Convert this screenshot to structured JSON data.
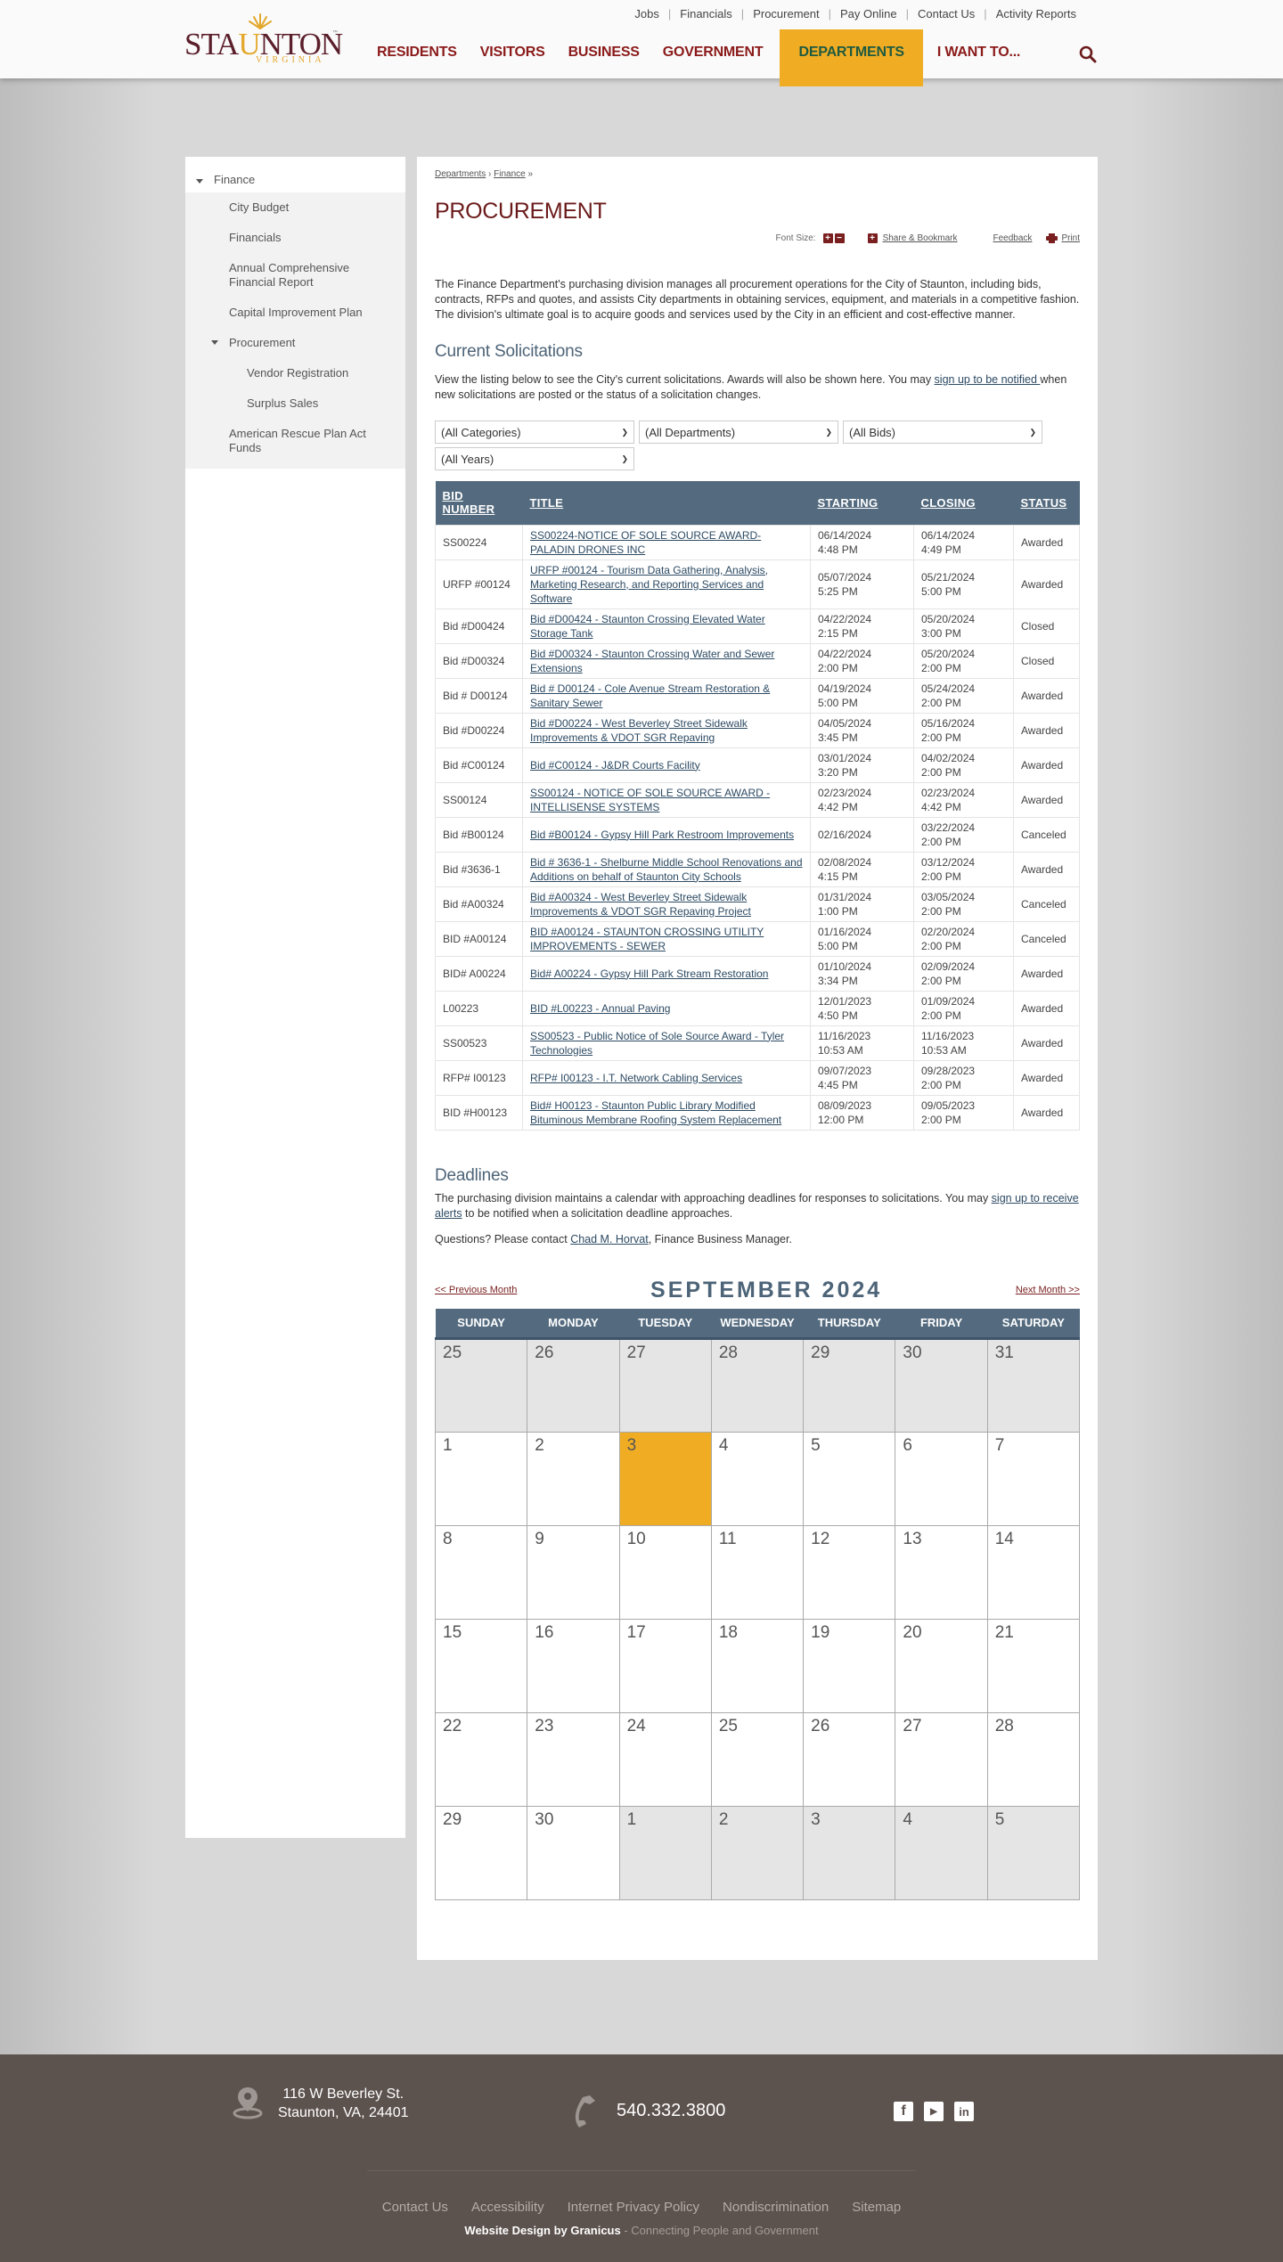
{
  "brand": {
    "name": "STAUNTON",
    "name_pre": "STA",
    "name_u": "U",
    "name_post": "NTON",
    "sub": "VIRGINIA",
    "tm": "™",
    "accent": "#f0ad24",
    "maroon": "#7a1f1f",
    "slate": "#546b7f"
  },
  "utility_nav": [
    "Jobs",
    "Financials",
    "Procurement",
    "Pay Online",
    "Contact Us",
    "Activity Reports"
  ],
  "main_nav": [
    {
      "label": "RESIDENTS",
      "active": false
    },
    {
      "label": "VISITORS",
      "active": false
    },
    {
      "label": "BUSINESS",
      "active": false
    },
    {
      "label": "GOVERNMENT",
      "active": false
    },
    {
      "label": "DEPARTMENTS",
      "active": true
    },
    {
      "label": "I WANT TO...",
      "active": false
    }
  ],
  "sidebar": {
    "top": "Finance",
    "items": [
      {
        "label": "City Budget"
      },
      {
        "label": "Financials"
      },
      {
        "label": "Annual Comprehensive Financial Report"
      },
      {
        "label": "Capital Improvement Plan"
      },
      {
        "label": "Procurement"
      },
      {
        "label": "Vendor Registration"
      },
      {
        "label": "Surplus Sales"
      },
      {
        "label": "American Rescue Plan Act Funds"
      }
    ]
  },
  "breadcrumb": [
    "Departments",
    "Finance"
  ],
  "breadcrumb_sep": "›",
  "breadcrumb_end": "»",
  "page_title": "PROCUREMENT",
  "tools": {
    "font_size": "Font Size:",
    "plus": "+",
    "minus": "−",
    "share": "Share & Bookmark",
    "feedback": "Feedback",
    "print": "Print"
  },
  "intro": "The Finance Department's purchasing division manages all procurement operations for the City of Staunton, including bids, contracts, RFPs and quotes, and assists City departments in obtaining services, equipment, and materials in a competitive fashion. The division's ultimate goal is to acquire goods and services used by the City in an efficient and cost-effective manner.",
  "solicitations": {
    "heading": "Current Solicitations",
    "text_before": "View the listing below to see the City's current solicitations. Awards will also be shown here. You may ",
    "link": "sign up to be notified ",
    "text_after": "when new solicitations are posted or the status of a solicitation changes.",
    "filters": [
      "(All Categories)",
      "(All Departments)",
      "(All Bids)",
      "(All Years)"
    ],
    "columns": [
      "BID NUMBER",
      "TITLE",
      "STARTING",
      "CLOSING",
      "STATUS"
    ],
    "rows": [
      {
        "bid": "SS00224",
        "title": "SS00224-NOTICE OF SOLE SOURCE AWARD-PALADIN DRONES INC",
        "start_date": "06/14/2024",
        "start_time": "4:48 PM",
        "close_date": "06/14/2024",
        "close_time": "4:49 PM",
        "status": "Awarded"
      },
      {
        "bid": "URFP #00124",
        "title": "URFP #00124 - Tourism Data Gathering, Analysis, Marketing Research, and Reporting Services and Software",
        "start_date": "05/07/2024",
        "start_time": "5:25 PM",
        "close_date": "05/21/2024",
        "close_time": "5:00 PM",
        "status": "Awarded"
      },
      {
        "bid": "Bid #D00424",
        "title": "Bid #D00424 - Staunton Crossing Elevated Water Storage Tank",
        "start_date": "04/22/2024",
        "start_time": "2:15 PM",
        "close_date": "05/20/2024",
        "close_time": "3:00 PM",
        "status": "Closed"
      },
      {
        "bid": "Bid #D00324",
        "title": "Bid #D00324 - Staunton Crossing Water and Sewer Extensions",
        "start_date": "04/22/2024",
        "start_time": "2:00 PM",
        "close_date": "05/20/2024",
        "close_time": "2:00 PM",
        "status": "Closed"
      },
      {
        "bid": "Bid # D00124",
        "title": "Bid # D00124 - Cole Avenue Stream Restoration & Sanitary Sewer",
        "start_date": "04/19/2024",
        "start_time": "5:00 PM",
        "close_date": "05/24/2024",
        "close_time": "2:00 PM",
        "status": "Awarded"
      },
      {
        "bid": "Bid #D00224",
        "title": "Bid #D00224 - West Beverley Street Sidewalk Improvements & VDOT SGR Repaving",
        "start_date": "04/05/2024",
        "start_time": "3:45 PM",
        "close_date": "05/16/2024",
        "close_time": "2:00 PM",
        "status": "Awarded"
      },
      {
        "bid": "Bid #C00124",
        "title": "Bid #C00124 - J&DR Courts Facility",
        "start_date": "03/01/2024",
        "start_time": "3:20 PM",
        "close_date": "04/02/2024",
        "close_time": "2:00 PM",
        "status": "Awarded"
      },
      {
        "bid": "SS00124",
        "title": "SS00124 - NOTICE OF SOLE SOURCE AWARD - INTELLISENSE SYSTEMS",
        "start_date": "02/23/2024",
        "start_time": "4:42 PM",
        "close_date": "02/23/2024",
        "close_time": "4:42 PM",
        "status": "Awarded"
      },
      {
        "bid": "Bid #B00124",
        "title": "Bid #B00124 - Gypsy Hill Park Restroom Improvements",
        "start_date": "02/16/2024",
        "start_time": "",
        "close_date": "03/22/2024",
        "close_time": "2:00 PM",
        "status": "Canceled"
      },
      {
        "bid": "Bid #3636-1",
        "title": "Bid # 3636-1 - Shelburne Middle School Renovations and Additions on behalf of Staunton City Schools",
        "start_date": "02/08/2024",
        "start_time": "4:15 PM",
        "close_date": "03/12/2024",
        "close_time": "2:00 PM",
        "status": "Awarded"
      },
      {
        "bid": "Bid #A00324",
        "title": "Bid #A00324 - West Beverley Street Sidewalk Improvements & VDOT SGR Repaving Project",
        "start_date": "01/31/2024",
        "start_time": "1:00 PM",
        "close_date": "03/05/2024",
        "close_time": "2:00 PM",
        "status": "Canceled"
      },
      {
        "bid": "BID #A00124",
        "title": "BID #A00124 - STAUNTON CROSSING UTILITY IMPROVEMENTS - SEWER",
        "start_date": "01/16/2024",
        "start_time": "5:00 PM",
        "close_date": "02/20/2024",
        "close_time": "2:00 PM",
        "status": "Canceled"
      },
      {
        "bid": "BID# A00224",
        "title": "Bid# A00224 - Gypsy Hill Park Stream Restoration",
        "start_date": "01/10/2024",
        "start_time": "3:34 PM",
        "close_date": "02/09/2024",
        "close_time": "2:00 PM",
        "status": "Awarded"
      },
      {
        "bid": "L00223",
        "title": "BID #L00223 - Annual Paving",
        "start_date": "12/01/2023",
        "start_time": "4:50 PM",
        "close_date": "01/09/2024",
        "close_time": "2:00 PM",
        "status": "Awarded"
      },
      {
        "bid": "SS00523",
        "title": "SS00523 - Public Notice of Sole Source Award - Tyler Technologies",
        "start_date": "11/16/2023",
        "start_time": "10:53 AM",
        "close_date": "11/16/2023",
        "close_time": "10:53 AM",
        "status": "Awarded"
      },
      {
        "bid": "RFP# I00123",
        "title": "RFP# I00123 - I.T. Network Cabling Services",
        "start_date": "09/07/2023",
        "start_time": "4:45 PM",
        "close_date": "09/28/2023",
        "close_time": "2:00 PM",
        "status": "Awarded"
      },
      {
        "bid": "BID #H00123",
        "title": "Bid# H00123 - Staunton Public Library Modified Bituminous Membrane Roofing System Replacement",
        "start_date": "08/09/2023",
        "start_time": "12:00 PM",
        "close_date": "09/05/2023",
        "close_time": "2:00 PM",
        "status": "Awarded"
      }
    ]
  },
  "deadlines": {
    "heading": "Deadlines",
    "text_before": "The purchasing division maintains a calendar with approaching deadlines for responses to solicitations. You may ",
    "link": "sign up to receive alerts",
    "text_after": " to be notified when a solicitation deadline approaches.",
    "contact_before": "Questions? Please contact ",
    "contact_link": "Chad M. Horvat",
    "contact_after": ",  Finance Business Manager."
  },
  "calendar": {
    "prev": "<< Previous Month",
    "next": "Next Month >>",
    "title": "SEPTEMBER 2024",
    "days": [
      "SUNDAY",
      "MONDAY",
      "TUESDAY",
      "WEDNESDAY",
      "THURSDAY",
      "FRIDAY",
      "SATURDAY"
    ],
    "weeks": [
      [
        {
          "d": "25",
          "other": true
        },
        {
          "d": "26",
          "other": true
        },
        {
          "d": "27",
          "other": true
        },
        {
          "d": "28",
          "other": true
        },
        {
          "d": "29",
          "other": true
        },
        {
          "d": "30",
          "other": true
        },
        {
          "d": "31",
          "other": true
        }
      ],
      [
        {
          "d": "1"
        },
        {
          "d": "2"
        },
        {
          "d": "3",
          "today": true
        },
        {
          "d": "4"
        },
        {
          "d": "5"
        },
        {
          "d": "6"
        },
        {
          "d": "7"
        }
      ],
      [
        {
          "d": "8"
        },
        {
          "d": "9"
        },
        {
          "d": "10"
        },
        {
          "d": "11"
        },
        {
          "d": "12"
        },
        {
          "d": "13"
        },
        {
          "d": "14"
        }
      ],
      [
        {
          "d": "15"
        },
        {
          "d": "16"
        },
        {
          "d": "17"
        },
        {
          "d": "18"
        },
        {
          "d": "19"
        },
        {
          "d": "20"
        },
        {
          "d": "21"
        }
      ],
      [
        {
          "d": "22"
        },
        {
          "d": "23"
        },
        {
          "d": "24"
        },
        {
          "d": "25"
        },
        {
          "d": "26"
        },
        {
          "d": "27"
        },
        {
          "d": "28"
        }
      ],
      [
        {
          "d": "29"
        },
        {
          "d": "30"
        },
        {
          "d": "1",
          "other": true
        },
        {
          "d": "2",
          "other": true
        },
        {
          "d": "3",
          "other": true
        },
        {
          "d": "4",
          "other": true
        },
        {
          "d": "5",
          "other": true
        }
      ]
    ]
  },
  "footer": {
    "address_line1": "116 W Beverley St.",
    "address_line2": "Staunton, VA, 24401",
    "phone": "540.332.3800",
    "social": [
      {
        "name": "facebook-icon",
        "glyph": "f"
      },
      {
        "name": "youtube-icon",
        "glyph": "▶"
      },
      {
        "name": "linkedin-icon",
        "glyph": "in"
      }
    ],
    "links": [
      "Contact Us",
      "Accessibility",
      "Internet Privacy Policy",
      "Nondiscrimination",
      "Sitemap"
    ],
    "credit_bold": "Website Design by Granicus",
    "credit_rest": " - Connecting People and Government"
  }
}
